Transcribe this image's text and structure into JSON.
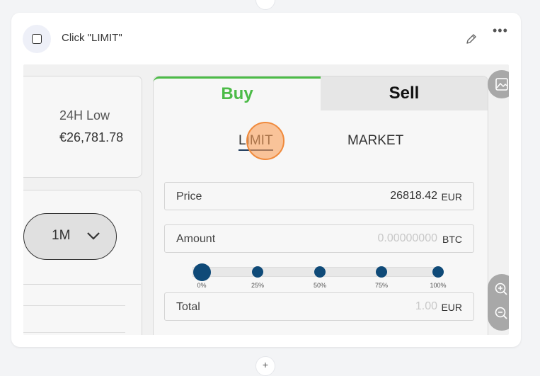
{
  "step": {
    "title": "Click \"LIMIT\""
  },
  "stats": {
    "low_label": "24H Low",
    "low_value": "€26,781.78"
  },
  "chart_controls": {
    "period": "1M"
  },
  "trade": {
    "tabs": {
      "buy": "Buy",
      "sell": "Sell"
    },
    "order_types": {
      "limit": "LIMIT",
      "market": "MARKET"
    },
    "price": {
      "label": "Price",
      "value": "26818.42",
      "unit": "EUR"
    },
    "amount": {
      "label": "Amount",
      "placeholder": "0.00000000",
      "unit": "BTC"
    },
    "slider": {
      "marks": [
        "0%",
        "25%",
        "50%",
        "75%",
        "100%"
      ],
      "value_percent": 0
    },
    "total": {
      "label": "Total",
      "placeholder": "1.00",
      "unit": "EUR"
    }
  },
  "colors": {
    "buy": "#4cbb47",
    "slider": "#0f4a78",
    "highlight": "#f08a3c"
  },
  "icons": [
    "checkbox-icon",
    "pencil-icon",
    "more-icon",
    "chevron-down-icon",
    "image-icon",
    "zoom-in-icon",
    "zoom-out-icon"
  ]
}
